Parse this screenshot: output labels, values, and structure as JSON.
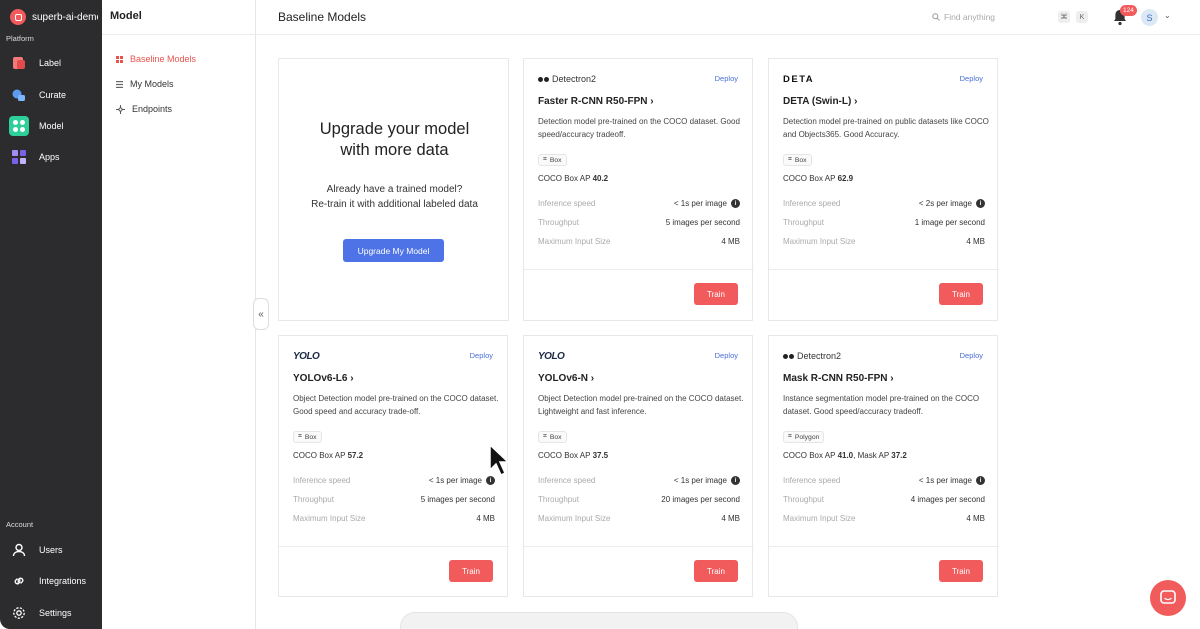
{
  "workspace": {
    "name": "superb-ai-demo"
  },
  "rail": {
    "platform_label": "Platform",
    "account_label": "Account",
    "platform_items": [
      {
        "label": "Label",
        "icon": "label-icon"
      },
      {
        "label": "Curate",
        "icon": "curate-icon"
      },
      {
        "label": "Model",
        "icon": "model-icon"
      },
      {
        "label": "Apps",
        "icon": "apps-icon"
      }
    ],
    "account_items": [
      {
        "label": "Users",
        "icon": "user-icon"
      },
      {
        "label": "Integrations",
        "icon": "link-icon"
      },
      {
        "label": "Settings",
        "icon": "gear-icon"
      }
    ]
  },
  "subnav": {
    "title": "Model",
    "items": [
      {
        "label": "Baseline Models"
      },
      {
        "label": "My Models"
      },
      {
        "label": "Endpoints"
      }
    ]
  },
  "header": {
    "title": "Baseline Models",
    "search_placeholder": "Find anything",
    "shortcut_keys": [
      "⌘",
      "K"
    ],
    "notification_count": "124",
    "avatar_initial": "S"
  },
  "upgrade_card": {
    "title": "Upgrade your model with more data",
    "subtitle_line1": "Already have a trained model?",
    "subtitle_line2": "Re-train it with additional labeled data",
    "button": "Upgrade My Model"
  },
  "common": {
    "deploy_label": "Deploy",
    "train_label": "Train",
    "stat_labels": {
      "inference": "Inference speed",
      "throughput": "Throughput",
      "max_input": "Maximum Input Size"
    }
  },
  "models": [
    {
      "brand": "Detectron2",
      "name": "Faster R-CNN R50-FPN",
      "desc": "Detection model pre-trained on the COCO dataset. Good speed/accuracy tradeoff.",
      "tag": "Box",
      "ap_label": "COCO Box AP",
      "ap_value": "40.2",
      "inference": "< 1s per image",
      "throughput": "5 images per second",
      "max_input": "4 MB"
    },
    {
      "brand": "DETA",
      "name": "DETA (Swin-L)",
      "desc": "Detection model pre-trained on public datasets like COCO and Objects365. Good Accuracy.",
      "tag": "Box",
      "ap_label": "COCO Box AP",
      "ap_value": "62.9",
      "inference": "< 2s per image",
      "throughput": "1 image per second",
      "max_input": "4 MB"
    },
    {
      "brand": "YOLO",
      "name": "YOLOv6-L6",
      "desc": "Object Detection model pre-trained on the COCO dataset. Good speed and accuracy trade-off.",
      "tag": "Box",
      "ap_label": "COCO Box AP",
      "ap_value": "57.2",
      "inference": "< 1s per image",
      "throughput": "5 images per second",
      "max_input": "4 MB"
    },
    {
      "brand": "YOLO",
      "name": "YOLOv6-N",
      "desc": "Object Detection model pre-trained on the COCO dataset. Lightweight and fast inference.",
      "tag": "Box",
      "ap_label": "COCO Box AP",
      "ap_value": "37.5",
      "inference": "< 1s per image",
      "throughput": "20 images per second",
      "max_input": "4 MB"
    },
    {
      "brand": "Detectron2",
      "name": "Mask R-CNN R50-FPN",
      "desc": "Instance segmentation model pre-trained on the COCO dataset. Good speed/accuracy tradeoff.",
      "tag": "Polygon",
      "ap_label": "COCO Box AP",
      "ap_value": "41.0",
      "ap2_label": "Mask AP",
      "ap2_value": "37.2",
      "inference": "< 1s per image",
      "throughput": "4 images per second",
      "max_input": "4 MB"
    }
  ],
  "colors": {
    "accent_red": "#f15b5b",
    "primary_blue": "#4d73e6",
    "active_green": "#2fcf9a",
    "rail_bg": "#2c2c2e"
  }
}
